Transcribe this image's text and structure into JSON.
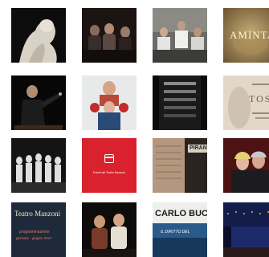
{
  "gallery": {
    "tiles": [
      {
        "label": ""
      },
      {
        "label": ""
      },
      {
        "label": ""
      },
      {
        "label": "AMINTA",
        "sub": ""
      },
      {
        "label": ""
      },
      {
        "label": ""
      },
      {
        "label": ""
      },
      {
        "label": "TOSCA",
        "sub": ""
      },
      {
        "label": ""
      },
      {
        "label": "",
        "caption": "Eventi del Teatro Manzoni"
      },
      {
        "label": "PIRAN"
      },
      {
        "label": ""
      },
      {
        "label": "Teatro Manzoni",
        "sub": "programmazione",
        "sub2": "gennaio - giugno 2017"
      },
      {
        "label": ""
      },
      {
        "label": "CARLO BUC",
        "sub": "IL DIRITTO DEL"
      },
      {
        "label": ""
      }
    ]
  },
  "colors": {
    "background": "#ffffff",
    "event_tile_red": "#d9222e"
  },
  "icons": {
    "event_tile": "calendar-icon"
  }
}
